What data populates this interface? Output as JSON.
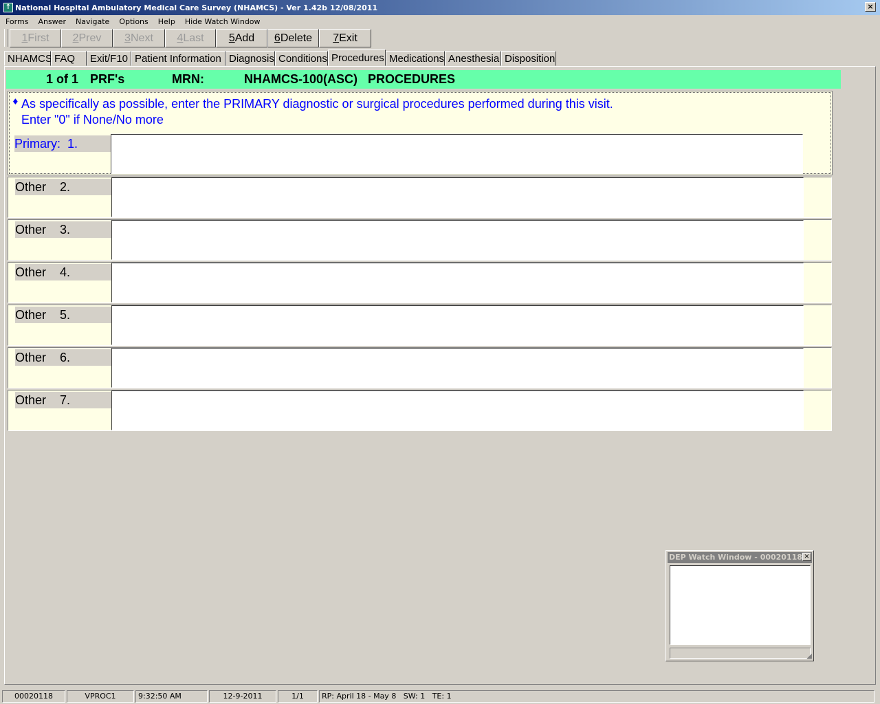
{
  "window": {
    "title": "National Hospital Ambulatory Medical Care Survey (NHAMCS) - Ver 1.42b 12/08/2011",
    "close": "×"
  },
  "menu": [
    "Forms",
    "Answer",
    "Navigate",
    "Options",
    "Help",
    "Hide Watch Window"
  ],
  "toolbar": [
    {
      "key": "1",
      "label": " First",
      "enabled": false
    },
    {
      "key": "2",
      "label": " Prev",
      "enabled": false
    },
    {
      "key": "3",
      "label": " Next",
      "enabled": false
    },
    {
      "key": "4",
      "label": " Last",
      "enabled": false
    },
    {
      "key": "5",
      "label": " Add",
      "enabled": true
    },
    {
      "key": "6",
      "label": " Delete",
      "enabled": true
    },
    {
      "key": "7",
      "label": " Exit",
      "enabled": true
    }
  ],
  "tabs": [
    "NHAMCS",
    "FAQ",
    "Exit/F10",
    "Patient Information",
    "Diagnosis",
    "Conditions",
    "Procedures",
    "Medications",
    "Anesthesia",
    "Disposition"
  ],
  "active_tab": "Procedures",
  "header": {
    "record": "1 of 1",
    "form": "PRF's",
    "mrn_label": "MRN:",
    "form_title": "NHAMCS-100(ASC)   PROCEDURES"
  },
  "instruction": {
    "line1": "As specifically as possible, enter the PRIMARY diagnostic or surgical procedures performed during this visit.",
    "line2": "Enter \"0\" if None/No more"
  },
  "procedures": [
    {
      "label": "Primary:  1.",
      "value": ""
    },
    {
      "label": "Other    2.",
      "value": ""
    },
    {
      "label": "Other    3.",
      "value": ""
    },
    {
      "label": "Other    4.",
      "value": ""
    },
    {
      "label": "Other    5.",
      "value": ""
    },
    {
      "label": "Other    6.",
      "value": ""
    },
    {
      "label": "Other    7.",
      "value": ""
    }
  ],
  "watch_window": {
    "title": "DEP Watch Window - 00020118",
    "close": "×"
  },
  "statusbar": {
    "id": "00020118",
    "screen": "VPROC1",
    "time": "9:32:50 AM",
    "date": "12-9-2011",
    "page": "1/1",
    "info": "RP: April 18 - May 8   SW: 1   TE: 1"
  }
}
